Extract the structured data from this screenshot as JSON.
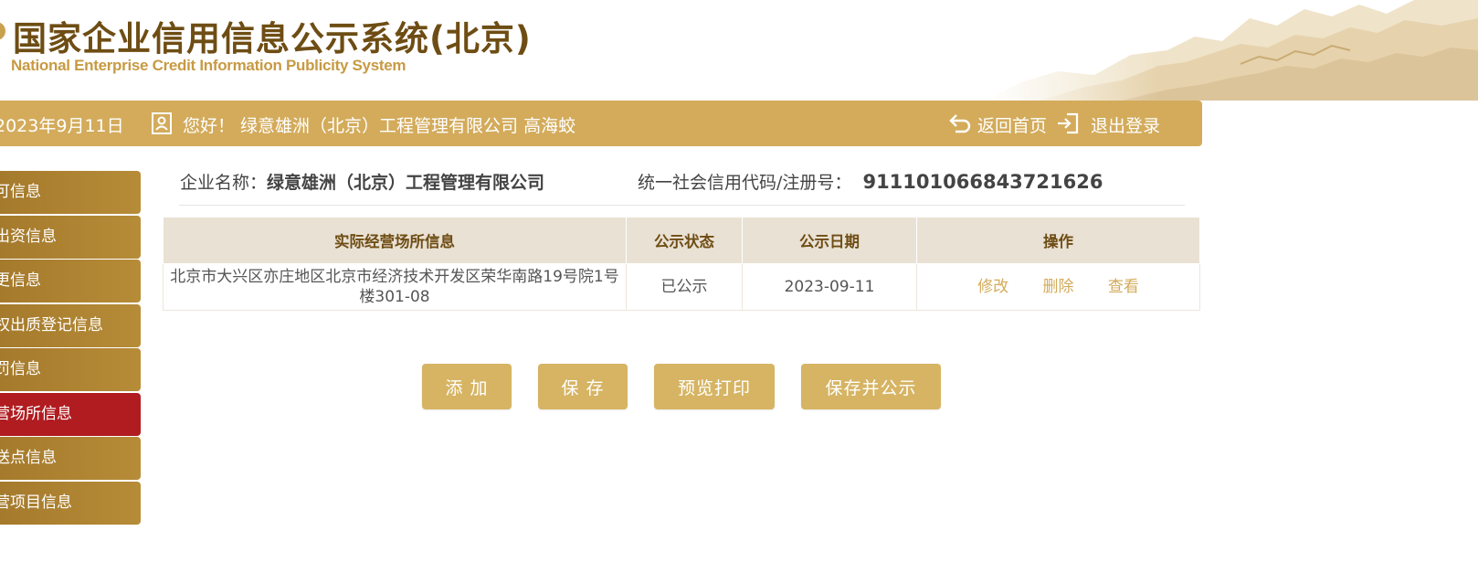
{
  "header": {
    "title_cn": "国家企业信用信息公示系统(北京)",
    "title_en": "National Enterprise Credit Information Publicity System"
  },
  "topbar": {
    "date": "2023年9月11日",
    "greeting": "您好！ 绿意雄洲（北京）工程管理有限公司  高海蛟",
    "home_label": "返回首页",
    "logout_label": "退出登录"
  },
  "sidebar": {
    "items": [
      {
        "label": "可信息",
        "active": false
      },
      {
        "label": "出资信息",
        "active": false
      },
      {
        "label": "更信息",
        "active": false
      },
      {
        "label": "权出质登记信息",
        "active": false
      },
      {
        "label": "罚信息",
        "active": false
      },
      {
        "label": "营场所信息",
        "active": true
      },
      {
        "label": "送点信息",
        "active": false
      },
      {
        "label": "营项目信息",
        "active": false
      }
    ]
  },
  "company": {
    "name_label": "企业名称：",
    "name": "绿意雄洲（北京）工程管理有限公司",
    "code_label": "统一社会信用代码/注册号：",
    "code": "911101066843721626"
  },
  "table": {
    "headers": [
      "实际经营场所信息",
      "公示状态",
      "公示日期",
      "操作"
    ],
    "rows": [
      {
        "address": "北京市大兴区亦庄地区北京市经济技术开发区荣华南路19号院1号楼301-08",
        "status": "已公示",
        "date": "2023-09-11",
        "actions": [
          "修改",
          "删除",
          "查看"
        ]
      }
    ]
  },
  "buttons": {
    "add": "添 加",
    "save": "保 存",
    "preview": "预览打印",
    "save_publish": "保存并公示"
  },
  "colors": {
    "gold": "#d3ab5b",
    "dark_gold": "#ad8430",
    "active_red": "#b01c20",
    "title_brown": "#6e4d14"
  }
}
